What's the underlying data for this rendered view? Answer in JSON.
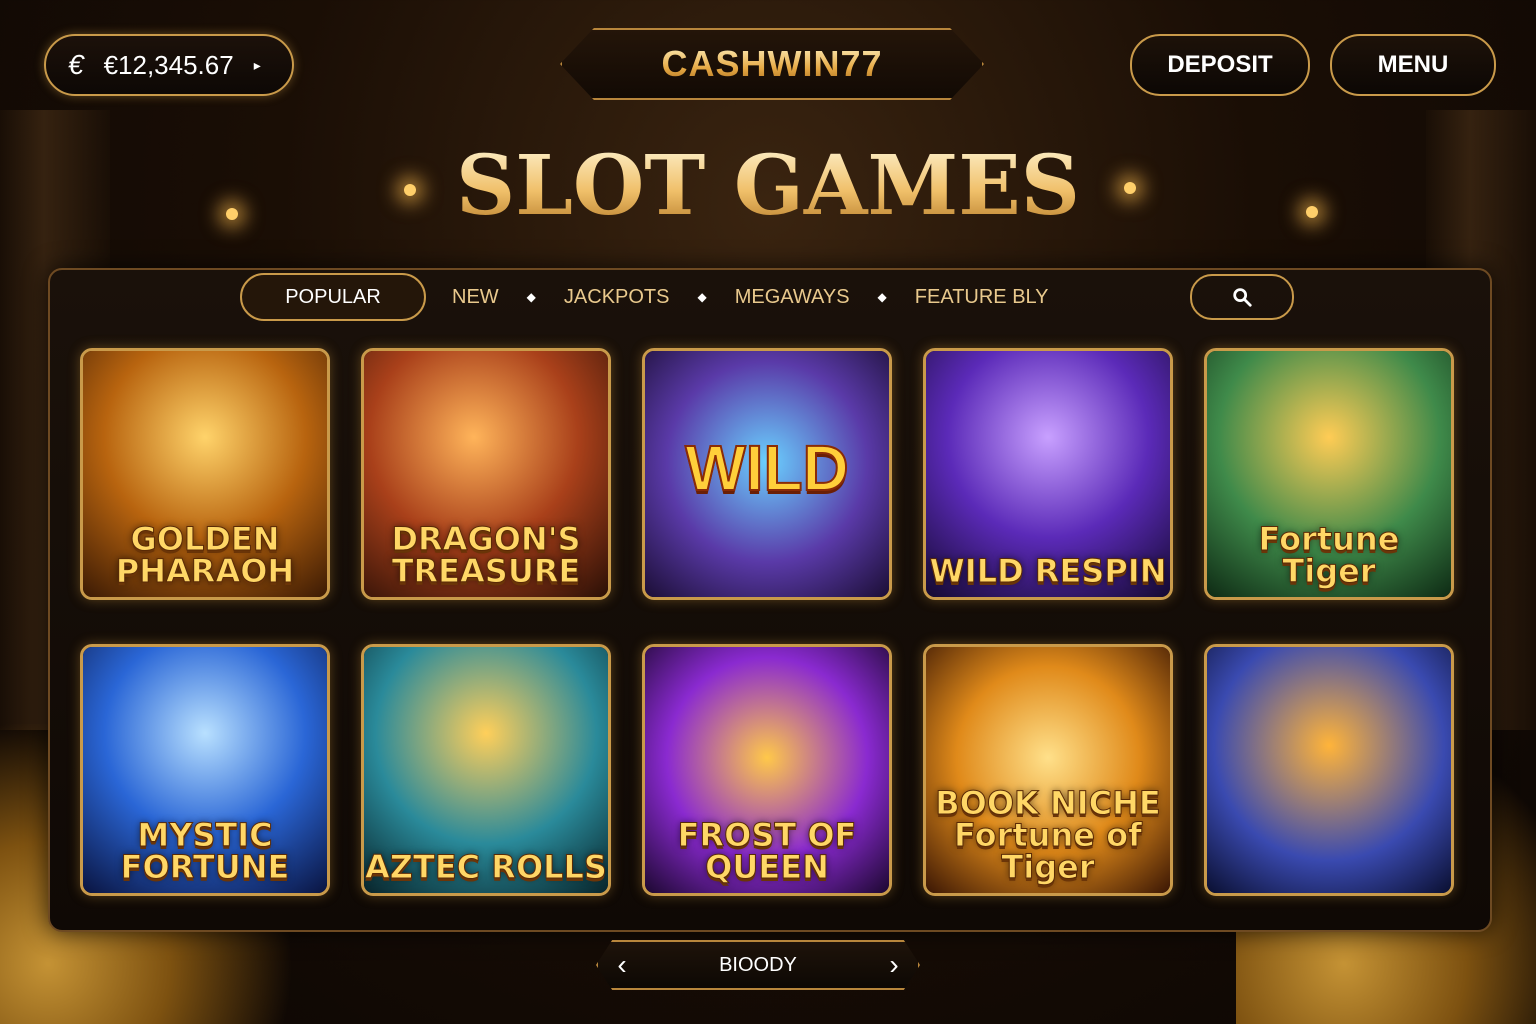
{
  "header": {
    "currency_symbol": "€",
    "balance": "€12,345.67",
    "balance_chevron": "▸",
    "logo": "CASHWIN77",
    "deposit_label": "DEPOSIT",
    "menu_label": "MENU"
  },
  "page_title": "SLOT GAMES",
  "tabs": [
    {
      "label": "POPULAR",
      "active": true
    },
    {
      "label": "NEW"
    },
    {
      "label": "JACKPOTS"
    },
    {
      "label": "MEGAWAYS"
    },
    {
      "label": "FEATURE BLY"
    }
  ],
  "search_icon": "search-icon",
  "games": [
    {
      "title": "GOLDEN PHARAOH",
      "accent": "#e7a12b"
    },
    {
      "title": "DRAGON'S TREASURE",
      "accent": "#c2541e"
    },
    {
      "title": "",
      "badge": "WILD",
      "accent": "#5a3aa8"
    },
    {
      "title": "WILD RESPIN",
      "accent": "#6a3ad0"
    },
    {
      "title": "Fortune Tiger",
      "accent": "#3f8a4a"
    },
    {
      "title": "MYSTIC FORTUNE",
      "accent": "#2a66d6"
    },
    {
      "title": "AZTEC ROLLS",
      "accent": "#2a8a9a"
    },
    {
      "title": "FROST OF QUEEN",
      "accent": "#8a2ad0"
    },
    {
      "title": "BOOK NICHE Fortune of Tiger",
      "accent": "#e08a1a"
    },
    {
      "title": "",
      "accent": "#3a4ab0"
    }
  ],
  "pager": {
    "prev_icon": "chevron-left-icon",
    "label": "BIOODY",
    "next_icon": "chevron-right-icon"
  }
}
